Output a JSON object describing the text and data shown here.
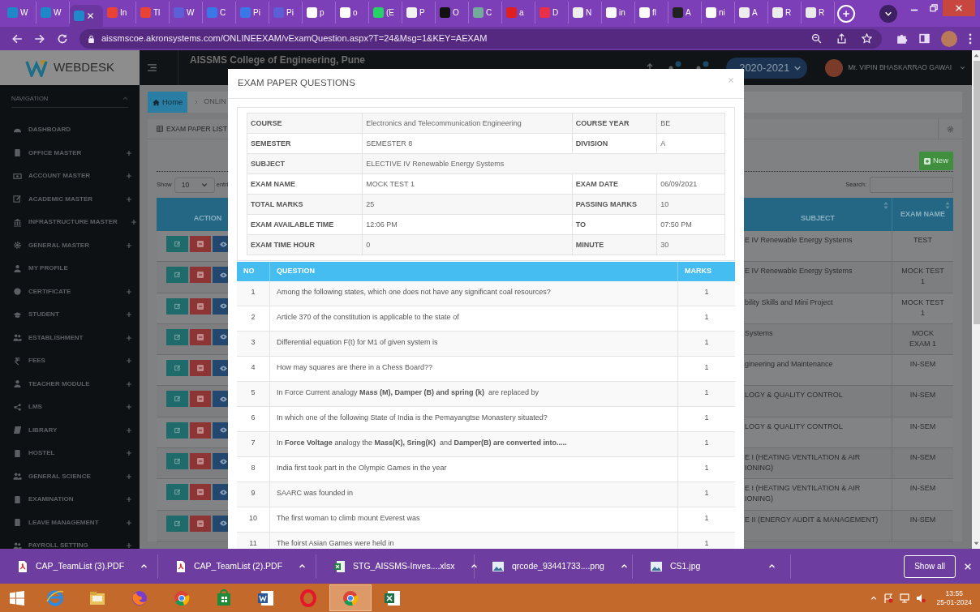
{
  "browser": {
    "tabs": [
      {
        "label": "W",
        "color": "#1e88c8",
        "selected": false
      },
      {
        "label": "W",
        "color": "#1e88c8",
        "selected": false
      },
      {
        "color": "#1e88c8",
        "selected": true
      },
      {
        "label": "In",
        "color": "#ea4335",
        "selected": false
      },
      {
        "label": "Tl",
        "color": "#ea4335",
        "selected": false
      },
      {
        "label": "W",
        "color": "#5c5fd6",
        "selected": false
      },
      {
        "label": "C",
        "color": "#3b78e7",
        "selected": false
      },
      {
        "label": "Pi",
        "color": "#3b78e7",
        "selected": false
      },
      {
        "label": "Pi",
        "color": "#5c5fd6",
        "selected": false
      },
      {
        "label": "p",
        "color": "#ffffff",
        "selected": false
      },
      {
        "label": "o",
        "color": "#ffffff",
        "selected": false
      },
      {
        "label": "(E",
        "color": "#25d366",
        "selected": false
      },
      {
        "label": "P",
        "color": "#f2f2f2",
        "selected": false
      },
      {
        "label": "O",
        "color": "#111111",
        "selected": false
      },
      {
        "label": "C",
        "color": "#74aa9c",
        "selected": false
      },
      {
        "label": "a",
        "color": "#e02020",
        "selected": false
      },
      {
        "label": "D",
        "color": "#e8304a",
        "selected": false
      },
      {
        "label": "N",
        "color": "#eeeeee",
        "selected": false
      },
      {
        "label": "in",
        "color": "#fafafa",
        "selected": false
      },
      {
        "label": "fl",
        "color": "#fbfbfb",
        "selected": false
      },
      {
        "label": "A",
        "color": "#222222",
        "selected": false
      },
      {
        "label": "ni",
        "color": "#fcfcfc",
        "selected": false
      },
      {
        "label": "A",
        "color": "#ededed",
        "selected": false
      },
      {
        "label": "R",
        "color": "#ececec",
        "selected": false
      },
      {
        "label": "R",
        "color": "#ebebeb",
        "selected": false
      }
    ],
    "url": "aissmscoe.akronsystems.com/ONLINEEXAM/vExamQuestion.aspx?T=24&Msg=1&KEY=AEXAM"
  },
  "header": {
    "logo": "WEBDESK",
    "college": "AISSMS College of Engineering, Pune",
    "academic_year": "2020-2021",
    "user": "Mr. VIPIN BHASKARRAO GAWAI"
  },
  "sidebar": {
    "heading": "NAVIGATION",
    "items": [
      {
        "label": "DASHBOARD",
        "expandable": false
      },
      {
        "label": "OFFICE MASTER",
        "expandable": true
      },
      {
        "label": "ACCOUNT MASTER",
        "expandable": true
      },
      {
        "label": "ACADEMIC MASTER",
        "expandable": true
      },
      {
        "label": "INFRASTRUCTURE MASTER",
        "expandable": true
      },
      {
        "label": "GENERAL MASTER",
        "expandable": true
      },
      {
        "label": "MY PROFILE",
        "expandable": false
      },
      {
        "label": "CERTIFICATE",
        "expandable": true
      },
      {
        "label": "STUDENT",
        "expandable": true
      },
      {
        "label": "ESTABLISHMENT",
        "expandable": true
      },
      {
        "label": "FEES",
        "expandable": true
      },
      {
        "label": "TEACHER MODULE",
        "expandable": true
      },
      {
        "label": "LMS",
        "expandable": true
      },
      {
        "label": "LIBRARY",
        "expandable": true
      },
      {
        "label": "HOSTEL",
        "expandable": true
      },
      {
        "label": "GENERAL SCIENCE",
        "expandable": true
      },
      {
        "label": "EXAMINATION",
        "expandable": true
      },
      {
        "label": "LEAVE MANAGEMENT",
        "expandable": true
      },
      {
        "label": "PAYROLL SETTING",
        "expandable": true
      }
    ]
  },
  "breadcrumb": {
    "home": "Home",
    "current": "ONLIN"
  },
  "panel": {
    "title": "EXAM PAPER LIST",
    "new_button": "New",
    "show_label": "Show",
    "page_size": "10",
    "entries_label": "entri",
    "search_label": "Search:"
  },
  "exam_table": {
    "columns": [
      "ACTION",
      "SUBJECT",
      "EXAM NAME"
    ],
    "rows": [
      {
        "subject": "E IV Renewable Energy Systems",
        "exam_name": "TEST"
      },
      {
        "subject": "E IV Renewable Energy Systems",
        "exam_name": "MOCK TEST\n1"
      },
      {
        "subject": "bility Skills and Mini Project",
        "exam_name": "MOCK TEST\n1"
      },
      {
        "subject": "Systems",
        "exam_name": "MOCK\nEXAM 1"
      },
      {
        "subject": "gineering and Maintenance",
        "exam_name": "IN-SEM"
      },
      {
        "subject": "LOGY & QUALITY CONTROL",
        "exam_name": "IN-SEM"
      },
      {
        "subject": "LOGY & QUALITY CONTROL",
        "exam_name": "IN-SEM"
      },
      {
        "subject": "E I (HEATING VENTILATION & AIR\nIONING)",
        "exam_name": "IN-SEM"
      },
      {
        "subject": "E I (HEATING VENTILATION & AIR\nIONING)",
        "exam_name": "IN-SEM"
      },
      {
        "subject": "E II (ENERGY AUDIT & MANAGEMENT)",
        "exam_name": "IN-SEM"
      }
    ]
  },
  "modal": {
    "title": "EXAM PAPER QUESTIONS",
    "details": [
      {
        "fields": [
          {
            "label": "COURSE",
            "value": "Electronics and Telecommunication Engineering"
          },
          {
            "label": "COURSE YEAR",
            "value": "BE"
          }
        ]
      },
      {
        "fields": [
          {
            "label": "SEMESTER",
            "value": "SEMESTER 8"
          },
          {
            "label": "DIVISION",
            "value": "A"
          }
        ]
      },
      {
        "fields": [
          {
            "label": "SUBJECT",
            "value": "ELECTIVE IV Renewable Energy Systems"
          }
        ]
      },
      {
        "fields": [
          {
            "label": "EXAM NAME",
            "value": "MOCK TEST 1"
          },
          {
            "label": "EXAM DATE",
            "value": "06/09/2021"
          }
        ]
      },
      {
        "fields": [
          {
            "label": "TOTAL MARKS",
            "value": "25"
          },
          {
            "label": "PASSING MARKS",
            "value": "10"
          }
        ]
      },
      {
        "fields": [
          {
            "label": "EXAM AVAILABLE TIME",
            "value": "12:06 PM"
          },
          {
            "label": "TO",
            "value": "07:50 PM"
          }
        ]
      },
      {
        "fields": [
          {
            "label": "EXAM TIME HOUR",
            "value": "0"
          },
          {
            "label": "MINUTE",
            "value": "30"
          }
        ]
      }
    ],
    "questions": {
      "columns": [
        "NO",
        "QUESTION",
        "MARKS"
      ],
      "rows": [
        {
          "no": "1",
          "text": "Among the following states, which one does not have any significant coal resources?",
          "marks": "1"
        },
        {
          "no": "2",
          "text": "Article 370 of the constitution is applicable to the state of",
          "marks": "1"
        },
        {
          "no": "3",
          "text": "Differential equation F(t) for M1 of given system is",
          "marks": "1"
        },
        {
          "no": "4",
          "text": "How may squares are there in a Chess Board??",
          "marks": "1"
        },
        {
          "no": "5",
          "text": "In Force Current analogy **Mass (M), Damper (B) and spring (k)**  are replaced by",
          "marks": "1"
        },
        {
          "no": "6",
          "text": "In which one of the following State of India is the Pemayangtse Monastery situated?",
          "marks": "1"
        },
        {
          "no": "7",
          "text": "In **Force Voltage** analogy the **Mass(K), Sring(K)**  and **Damper(B) are converted into.....**",
          "marks": "1"
        },
        {
          "no": "8",
          "text": "India first took part in the Olympic Games in the year",
          "marks": "1"
        },
        {
          "no": "9",
          "text": "SAARC was founded in",
          "marks": "1"
        },
        {
          "no": "10",
          "text": "The first woman to climb mount Everest was",
          "marks": "1"
        },
        {
          "no": "11",
          "text": "The foirst Asian Games were held in",
          "marks": "1"
        }
      ]
    }
  },
  "downloads": {
    "items": [
      {
        "name": "CAP_TeamList (3).PDF",
        "kind": "pdf"
      },
      {
        "name": "CAP_TeamList (2).PDF",
        "kind": "pdf"
      },
      {
        "name": "STG_AISSMS-Inves....xlsx",
        "kind": "spreadsheet"
      },
      {
        "name": "qrcode_93441733....png",
        "kind": "image"
      },
      {
        "name": "CS1.jpg",
        "kind": "image"
      }
    ],
    "show_all": "Show all"
  },
  "taskbar": {
    "apps": [
      {
        "selected": false
      },
      {
        "selected": false
      },
      {
        "selected": false
      },
      {
        "selected": false
      },
      {
        "selected": false
      },
      {
        "selected": false
      },
      {
        "selected": false
      },
      {
        "selected": true
      },
      {
        "selected": false
      }
    ],
    "time": "13:55",
    "date": "25-01-2024"
  }
}
